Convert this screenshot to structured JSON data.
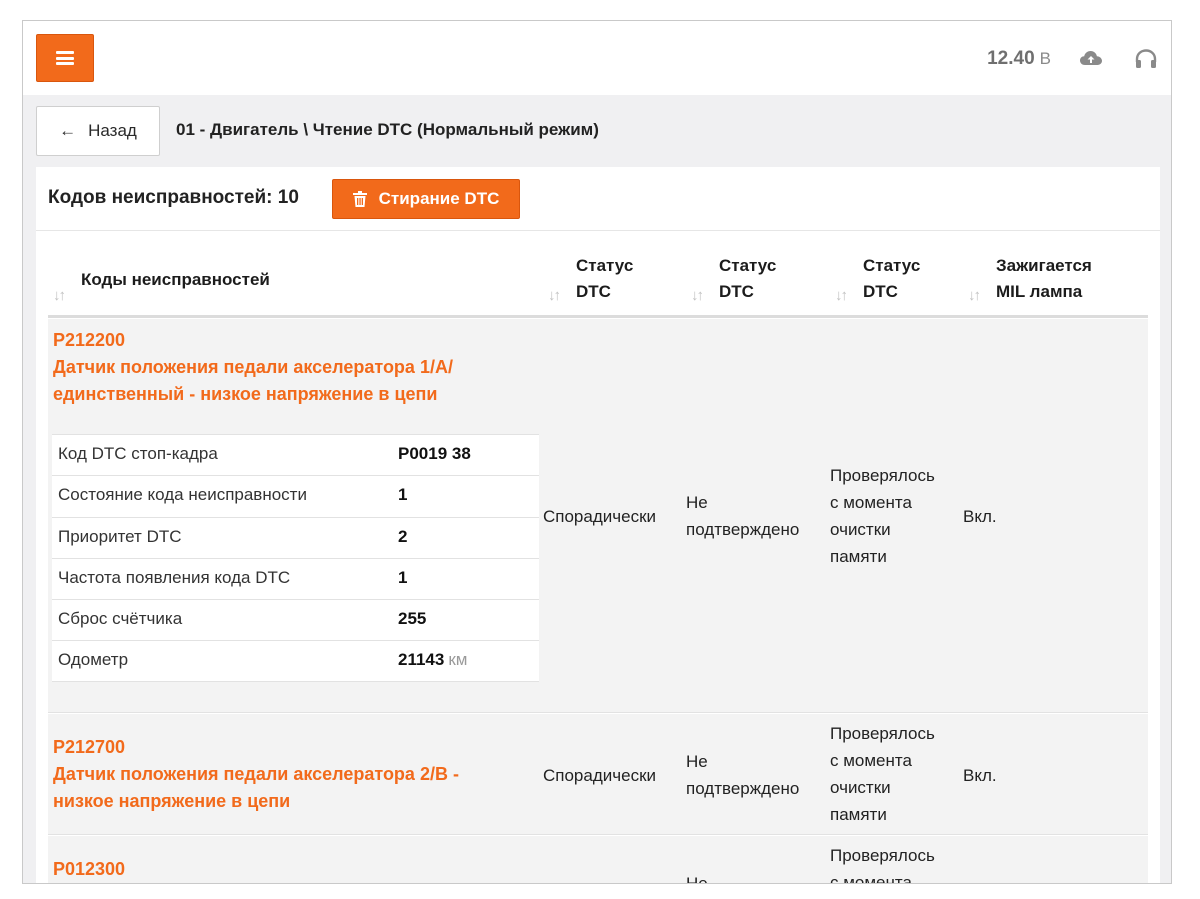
{
  "header": {
    "voltage_value": "12.40",
    "voltage_unit": "В",
    "icons": [
      "menu-icon",
      "cloud-upload-icon",
      "headset-icon"
    ]
  },
  "nav": {
    "back_label": "Назад",
    "breadcrumb": "01 - Двигатель \\ Чтение DTC (Нормальный режим)"
  },
  "summary": {
    "count_label": "Кодов неисправностей: 10",
    "erase_label": "Стирание DTC"
  },
  "table": {
    "columns": [
      {
        "line1": "Коды неисправностей",
        "line2": ""
      },
      {
        "line1": "Статус",
        "line2": "DTC"
      },
      {
        "line1": "Статус",
        "line2": "DTC"
      },
      {
        "line1": "Статус",
        "line2": "DTC"
      },
      {
        "line1": "Зажигается",
        "line2": "MIL лампа"
      }
    ],
    "rows": [
      {
        "code": "P212200",
        "desc_line1": "Датчик положения педали акселератора 1/A/",
        "desc_line2": "единственный - низкое напряжение в цепи",
        "status1": "Спорадически",
        "status2_l1": "Не",
        "status2_l2": "подтверждено",
        "status3_l1": "Проверялось",
        "status3_l2": "с момента",
        "status3_l3": "очистки",
        "status3_l4": "памяти",
        "mil": "Вкл.",
        "details": [
          {
            "label": "Код DTC стоп-кадра",
            "value": "P0019 38",
            "unit": ""
          },
          {
            "label": "Состояние кода неисправности",
            "value": "1",
            "unit": ""
          },
          {
            "label": "Приоритет DTC",
            "value": "2",
            "unit": ""
          },
          {
            "label": "Частота появления кода DTC",
            "value": "1",
            "unit": ""
          },
          {
            "label": "Сброс счётчика",
            "value": "255",
            "unit": ""
          },
          {
            "label": "Одометр",
            "value": "21143",
            "unit": "км"
          }
        ]
      },
      {
        "code": "P212700",
        "desc_line1": "Датчик положения педали акселератора 2/B -",
        "desc_line2": "низкое напряжение в цепи",
        "status1": "Спорадически",
        "status2_l1": "Не",
        "status2_l2": "подтверждено",
        "status3_l1": "Проверялось",
        "status3_l2": "с момента",
        "status3_l3": "очистки",
        "status3_l4": "памяти",
        "mil": "Вкл."
      },
      {
        "code": "P012300",
        "status2_l1": "Не",
        "status3_l1": "Проверялось",
        "status3_l2": "с момента"
      }
    ]
  },
  "colors": {
    "accent": "#f26a1b",
    "background": "#f0f0f2",
    "row_bg": "#f3f3f3"
  }
}
